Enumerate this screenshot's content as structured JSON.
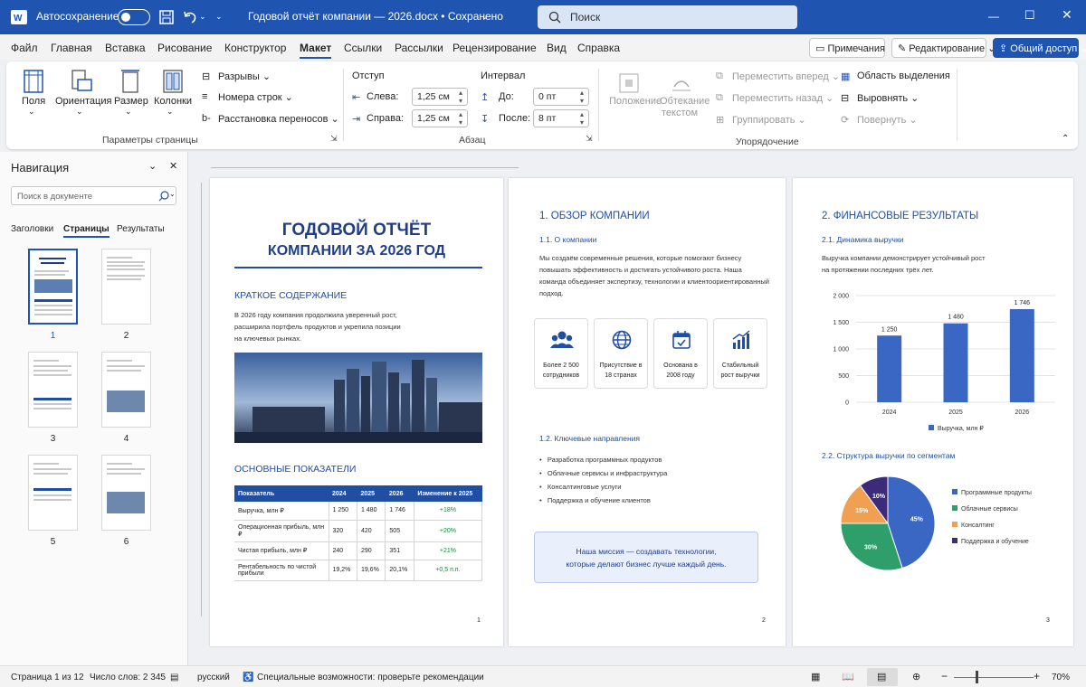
{
  "titlebar": {
    "autosave": "Автосохранение",
    "doc_title": "Годовой отчёт компании — 2026.docx • Сохранено",
    "search_placeholder": "Поиск"
  },
  "tabs": [
    "Файл",
    "Главная",
    "Вставка",
    "Рисование",
    "Конструктор",
    "Макет",
    "Ссылки",
    "Рассылки",
    "Рецензирование",
    "Вид",
    "Справка"
  ],
  "topbuttons": {
    "comments": "Примечания",
    "editing": "Редактирование",
    "share": "Общий доступ"
  },
  "ribbon": {
    "page_setup": {
      "fields": "Поля",
      "orientation": "Ориентация",
      "size": "Размер",
      "columns": "Колонки",
      "breaks": "Разрывы",
      "line_numbers": "Номера строк",
      "hyphenation": "Расстановка переносов",
      "group": "Параметры страницы"
    },
    "paragraph": {
      "indent": "Отступ",
      "left": "Слева:",
      "left_val": "1,25 см",
      "right": "Справа:",
      "right_val": "1,25 см",
      "spacing": "Интервал",
      "before": "До:",
      "before_val": "0 пт",
      "after": "После:",
      "after_val": "8 пт",
      "group": "Абзац"
    },
    "arrange": {
      "position": "Положение",
      "wrap1": "Обтекание",
      "wrap2": "текстом",
      "forward": "Переместить вперед",
      "backward": "Переместить назад",
      "group_objs": "Группировать",
      "selection": "Область выделения",
      "align": "Выровнять",
      "rotate": "Повернуть",
      "group": "Упорядочение"
    }
  },
  "nav": {
    "title": "Навигация",
    "search_placeholder": "Поиск в документе",
    "tabs": [
      "Заголовки",
      "Страницы",
      "Результаты"
    ],
    "pages": [
      "1",
      "2",
      "3",
      "4",
      "5",
      "6"
    ]
  },
  "page1": {
    "title1": "ГОДОВОЙ ОТЧЁТ",
    "title2": "КОМПАНИИ ЗА 2026 ГОД",
    "summary_h": "КРАТКОЕ СОДЕРЖАНИЕ",
    "summary_lines": [
      "В 2026 году компания продолжила уверенный рост,",
      "расширила портфель продуктов и укрепила позиции",
      "на ключевых рынках."
    ],
    "kpi_h": "ОСНОВНЫЕ ПОКАЗАТЕЛИ",
    "table": {
      "headers": [
        "Показатель",
        "2024",
        "2025",
        "2026",
        "Изменение к 2025"
      ],
      "rows": [
        [
          "Выручка, млн ₽",
          "1 250",
          "1 480",
          "1 746",
          "+18%"
        ],
        [
          "Операционная прибыль, млн ₽",
          "320",
          "420",
          "505",
          "+20%"
        ],
        [
          "Чистая прибыль, млн ₽",
          "240",
          "290",
          "351",
          "+21%"
        ],
        [
          "Рентабельность по чистой прибыли",
          "19,2%",
          "19,6%",
          "20,1%",
          "+0,5 п.п."
        ]
      ]
    },
    "num": "1"
  },
  "page2": {
    "h": "1. ОБЗОР КОМПАНИИ",
    "sub1": "1.1. О компании",
    "about_lines": [
      "Мы создаём современные решения, которые помогают бизнесу",
      "повышать эффективность и достигать устойчивого роста. Наша",
      "команда объединяет экспертизу, технологии и клиентоориентированный",
      "подход."
    ],
    "cards": [
      {
        "icon": "people-icon",
        "l1": "Более 2 500",
        "l2": "сотрудников"
      },
      {
        "icon": "globe-icon",
        "l1": "Присутствие в",
        "l2": "18 странах"
      },
      {
        "icon": "calendar-icon",
        "l1": "Основана в",
        "l2": "2008 году"
      },
      {
        "icon": "growth-chart-icon",
        "l1": "Стабильный",
        "l2": "рост выручки"
      }
    ],
    "sub2": "1.2. Ключевые направления",
    "bullets": [
      "Разработка программных продуктов",
      "Облачные сервисы и инфраструктура",
      "Консалтинговые услуги",
      "Поддержка и обучение клиентов"
    ],
    "mission1": "Наша миссия — создавать технологии,",
    "mission2": "которые делают бизнес лучше каждый день.",
    "num": "2"
  },
  "page3": {
    "h": "2. ФИНАНСОВЫЕ РЕЗУЛЬТАТЫ",
    "sub1": "2.1. Динамика выручки",
    "text_lines": [
      "Выручка компании демонстрирует устойчивый рост",
      "на протяжении последних трёх лет."
    ],
    "sub2": "2.2. Структура выручки по сегментам",
    "num": "3"
  },
  "chart_data": [
    {
      "type": "bar",
      "categories": [
        "2024",
        "2025",
        "2026"
      ],
      "series": [
        {
          "name": "Выручка, млн ₽",
          "values": [
            1250,
            1480,
            1746
          ]
        }
      ],
      "value_labels": [
        "1 250",
        "1 480",
        "1 746"
      ],
      "ylim": [
        0,
        2000
      ],
      "yticks": [
        "0",
        "250",
        "500",
        "750",
        "1 000",
        "1 250",
        "1 500",
        "1 750",
        "2 000"
      ],
      "color": "#3a66c4",
      "legend": "bottom"
    },
    {
      "type": "pie",
      "categories": [
        "Программные продукты",
        "Облачные сервисы",
        "Консалтинг",
        "Поддержка и обучение"
      ],
      "values": [
        45,
        30,
        15,
        10
      ],
      "labels": [
        "45%",
        "30%",
        "15%",
        "10%"
      ],
      "colors": [
        "#3a66c4",
        "#2e9e6b",
        "#f0a050",
        "#3d2a7a"
      ],
      "legend": "right"
    }
  ],
  "status": {
    "page": "Страница 1 из 12",
    "words": "Число слов: 2 345",
    "lang": "русский",
    "access": "Специальные возможности: проверьте рекомендации",
    "zoom": "70%"
  }
}
